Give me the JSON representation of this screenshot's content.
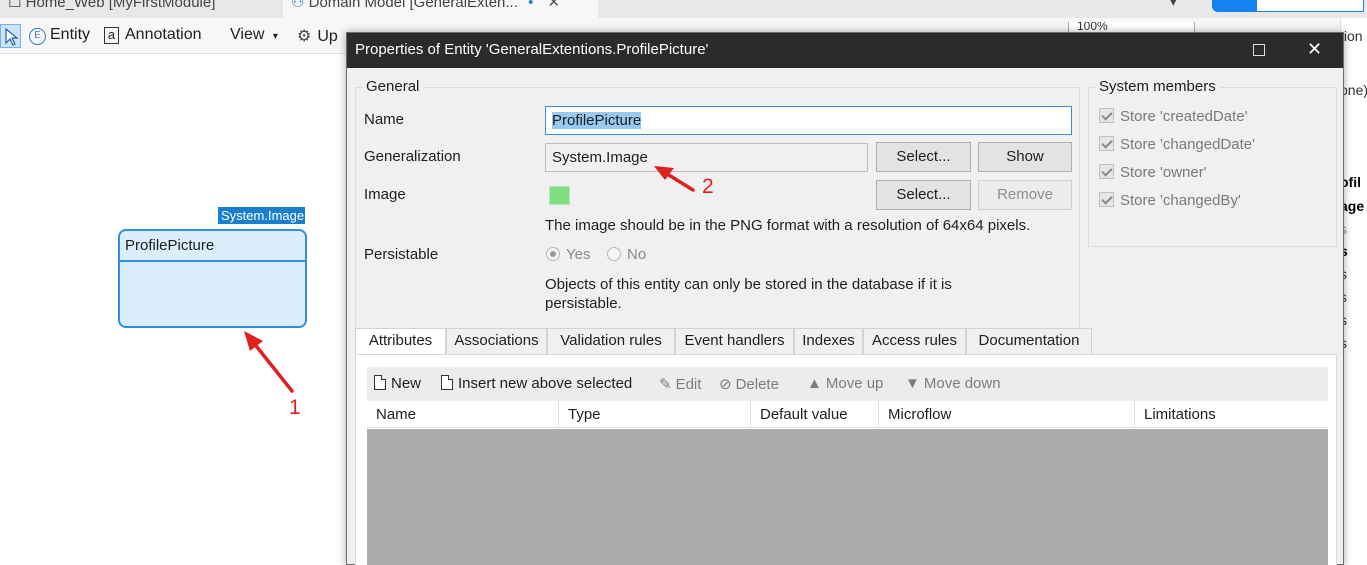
{
  "ide": {
    "tabs": [
      {
        "label": "Home_Web [MyFirstModule]"
      },
      {
        "label": "Domain Model [GeneralExten...",
        "modified": "•",
        "close": "✕"
      }
    ],
    "tab_overflow": "▾",
    "toolbar": {
      "entity_label": "Entity",
      "annotation_label": "Annotation",
      "view_label": "View",
      "view_caret": "▾",
      "update_label": "Up",
      "zoom_value": "100%"
    },
    "canvas": {
      "generalization_label": "System.Image",
      "entity_name": "ProfilePicture"
    },
    "right_panel": {
      "lines": [
        {
          "text": "tion",
          "style": "n"
        },
        {
          "text": "one)",
          "style": "n"
        },
        {
          "text": "ofil",
          "style": "b"
        },
        {
          "text": "age",
          "style": "b"
        },
        {
          "text": "s",
          "style": "g"
        },
        {
          "text": "s",
          "style": "b"
        },
        {
          "text": "s",
          "style": "n"
        },
        {
          "text": "s",
          "style": "n"
        },
        {
          "text": "s",
          "style": "n"
        },
        {
          "text": "s",
          "style": "n"
        }
      ]
    }
  },
  "dialog": {
    "title": "Properties of Entity 'GeneralExtentions.ProfilePicture'",
    "general": {
      "legend": "General",
      "name_label": "Name",
      "name_value": "ProfilePicture",
      "generalization_label": "Generalization",
      "generalization_value": "System.Image",
      "select_label": "Select...",
      "show_label": "Show",
      "image_label": "Image",
      "image_color": "#80dd80",
      "image_select_label": "Select...",
      "remove_label": "Remove",
      "image_note": "The image should be in the PNG format with a resolution of 64x64 pixels.",
      "persistable_label": "Persistable",
      "yes_label": "Yes",
      "no_label": "No",
      "persistable_note_line1": "Objects of this entity can only be stored in the database if it is",
      "persistable_note_line2": "persistable."
    },
    "system_members": {
      "legend": "System members",
      "items": [
        {
          "label": "Store 'createdDate'",
          "checked": true
        },
        {
          "label": "Store 'changedDate'",
          "checked": true
        },
        {
          "label": "Store 'owner'",
          "checked": true
        },
        {
          "label": "Store 'changedBy'",
          "checked": true
        }
      ]
    },
    "tabs": [
      {
        "label": "Attributes",
        "active": true
      },
      {
        "label": "Associations"
      },
      {
        "label": "Validation rules"
      },
      {
        "label": "Event handlers"
      },
      {
        "label": "Indexes"
      },
      {
        "label": "Access rules"
      },
      {
        "label": "Documentation"
      }
    ],
    "grid_toolbar": {
      "new_label": "New",
      "insert_label": "Insert new above selected",
      "edit_label": "Edit",
      "delete_label": "Delete",
      "move_up_label": "Move up",
      "move_down_label": "Move down"
    },
    "grid_columns": [
      "Name",
      "Type",
      "Default value",
      "Microflow",
      "Limitations"
    ]
  },
  "annotations": {
    "color": "#e02020",
    "marker_1": "1",
    "marker_2": "2"
  }
}
